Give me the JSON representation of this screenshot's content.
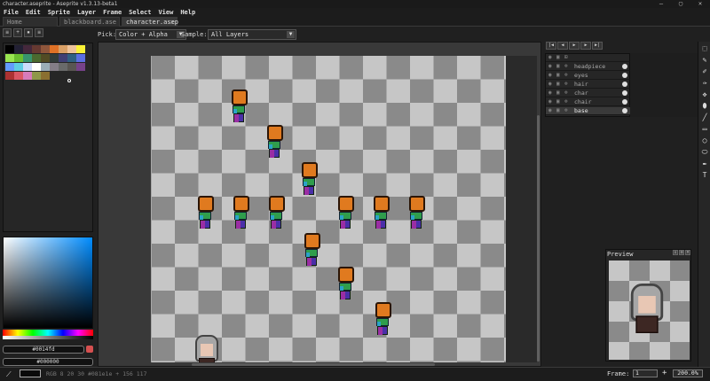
{
  "window": {
    "title": "character.aseprite - Aseprite v1.3.13-beta1",
    "min": "–",
    "max": "▢",
    "close": "✕"
  },
  "menu": [
    "File",
    "Edit",
    "Sprite",
    "Layer",
    "Frame",
    "Select",
    "View",
    "Help"
  ],
  "tabs": [
    {
      "label": "Home",
      "active": false
    },
    {
      "label": "blackboard.ase",
      "active": false
    },
    {
      "label": "character.asep",
      "active": true
    }
  ],
  "context": {
    "pick_label": "Pick:",
    "pick_value": "Color + Alpha",
    "sample_label": "Sample:",
    "sample_value": "All Layers"
  },
  "palette": {
    "colors": [
      "#000000",
      "#222034",
      "#45283c",
      "#663931",
      "#8f563b",
      "#df7126",
      "#d9a066",
      "#eec39a",
      "#fbf236",
      "#99e550",
      "#6abe30",
      "#37946e",
      "#4b692f",
      "#524b24",
      "#323c39",
      "#3f3f74",
      "#306082",
      "#5b6ee1",
      "#639bff",
      "#5fcde4",
      "#cbdbfc",
      "#ffffff",
      "#9badb7",
      "#847e87",
      "#696a6a",
      "#595652",
      "#76428a",
      "#ac3232",
      "#d95763",
      "#d77bba",
      "#8f974a",
      "#8a6f30"
    ]
  },
  "colors": {
    "fg_hex": "#0014fd",
    "bg_hex": "#000000"
  },
  "layers": [
    {
      "name": "headpiece",
      "active": false
    },
    {
      "name": "eyes",
      "active": false
    },
    {
      "name": "hair",
      "active": false
    },
    {
      "name": "char",
      "active": false
    },
    {
      "name": "chair",
      "active": false
    },
    {
      "name": "base",
      "active": true
    }
  ],
  "preview": {
    "title": "Preview"
  },
  "status": {
    "text": "RGB 8 20 30 #081e1e  +  156 117",
    "frame_label": "Frame:",
    "frame_value": "1",
    "zoom_plus": "+",
    "zoom_value": "200.0%"
  },
  "tools": [
    "⬚",
    "✎",
    "✐",
    "✑",
    "✥",
    "⬮",
    "╱",
    "▭",
    "◯",
    "⬭",
    "✒",
    "T"
  ]
}
